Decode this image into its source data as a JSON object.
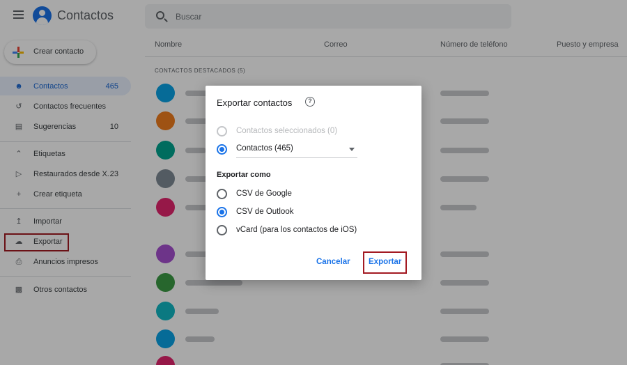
{
  "header": {
    "app_title": "Contactos",
    "search_placeholder": "Buscar"
  },
  "sidebar": {
    "create_label": "Crear contacto",
    "items": [
      {
        "label": "Contactos",
        "count": "465",
        "icon": "person-icon"
      },
      {
        "label": "Contactos frecuentes",
        "count": "",
        "icon": "history-icon"
      },
      {
        "label": "Sugerencias",
        "count": "10",
        "icon": "suggestion-icon"
      },
      {
        "label": "Etiquetas",
        "count": "",
        "icon": "chevron-up-icon"
      },
      {
        "label": "Restaurados desde X...",
        "count": "23",
        "icon": "label-icon"
      },
      {
        "label": "Crear etiqueta",
        "count": "",
        "icon": "plus-icon"
      },
      {
        "label": "Importar",
        "count": "",
        "icon": "upload-icon"
      },
      {
        "label": "Exportar",
        "count": "",
        "icon": "cloud-download-icon"
      },
      {
        "label": "Anuncios impresos",
        "count": "",
        "icon": "print-icon"
      },
      {
        "label": "Otros contactos",
        "count": "",
        "icon": "archive-icon"
      }
    ]
  },
  "table": {
    "columns": [
      "Nombre",
      "Correo",
      "Número de teléfono",
      "Puesto y empresa"
    ],
    "section_title": "CONTACTOS DESTACADOS (5)",
    "avatar_colors": [
      "#0aa3e6",
      "#f07d1e",
      "#00a58f",
      "#7e8b95",
      "#e4256e",
      "#a64fd1",
      "#3c9b45",
      "#12b8c4",
      "#0aa3e6",
      "#e4256e"
    ]
  },
  "dialog": {
    "title": "Exportar contactos",
    "option_selected": "Contactos seleccionados (0)",
    "option_contacts": "Contactos (465)",
    "export_as_label": "Exportar como",
    "formats": [
      "CSV de Google",
      "CSV de Outlook",
      "vCard (para los contactos de iOS)"
    ],
    "selected_format": "CSV de Outlook",
    "cancel_label": "Cancelar",
    "export_label": "Exportar"
  },
  "colors": {
    "accent": "#1a73e8",
    "highlight": "#a31a22"
  }
}
